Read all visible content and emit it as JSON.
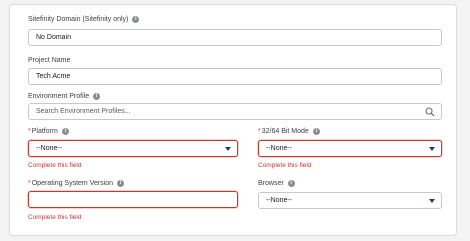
{
  "form": {
    "sitefinity_domain": {
      "label": "Sitefinity Domain (Sitefinity only)",
      "value": "No Domain"
    },
    "project_name": {
      "label": "Project Name",
      "value": "Tech Acme"
    },
    "environment_profile": {
      "label": "Environment Profile",
      "placeholder": "Search Environment Profiles..."
    },
    "platform": {
      "required_mark": "*",
      "label": "Platform",
      "value": "--None--",
      "error": "Complete this field"
    },
    "bit_mode": {
      "required_mark": "*",
      "label": "32/64 Bit Mode",
      "value": "--None--",
      "error": "Complete this field"
    },
    "os_version": {
      "required_mark": "*",
      "label": "Operating System Version",
      "value": "",
      "error": "Complete this field"
    },
    "browser": {
      "label": "Browser",
      "value": "--None--"
    }
  },
  "icons": {
    "info": "info-icon",
    "search": "search-icon",
    "dropdown": "chevron-down-icon"
  },
  "colors": {
    "error": "#c23934",
    "border": "#c9c9c9",
    "caret": "#1b3f75"
  }
}
